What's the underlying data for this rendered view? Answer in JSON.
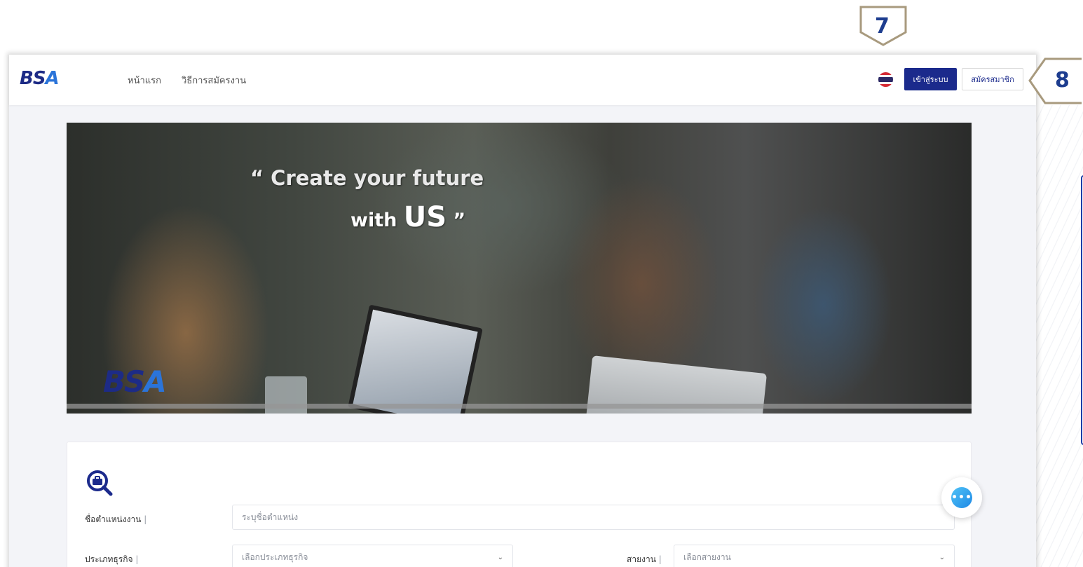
{
  "navbar": {
    "logo_text_1": "BS",
    "logo_text_2": "A",
    "nav_home": "หน้าแรก",
    "nav_how_to_apply": "วิธีการสมัครงาน",
    "language_flag": "thai-flag-icon",
    "login_label": "เข้าสู่ระบบ",
    "register_label": "สมัครสมาชิก"
  },
  "hero": {
    "quote_line1": "“ Create your future",
    "quote_line2_prefix": "with ",
    "quote_line2_big": "US",
    "quote_line2_suffix": " ”",
    "logo_text_1": "BS",
    "logo_text_2": "A"
  },
  "search": {
    "icon": "briefcase-search-icon",
    "position_label": "ชื่อตำแหน่งงาน",
    "position_placeholder": "ระบุชื่อตำแหน่ง",
    "business_type_label": "ประเภทธุรกิจ",
    "business_type_selected": "เลือกประเภทธุรกิจ",
    "job_line_label": "สายงาน",
    "job_line_selected": "เลือกสายงาน",
    "pipe": "|"
  },
  "chat": {
    "icon": "chat-bubble-icon",
    "glyph": "•••"
  },
  "annotations": {
    "callout_7": "7",
    "callout_8": "8"
  },
  "colors": {
    "brand_navy": "#1b2a8c",
    "brand_blue": "#2b74d9",
    "callout_outline": "#a89a7e",
    "callout_text": "#1d3d8f"
  }
}
